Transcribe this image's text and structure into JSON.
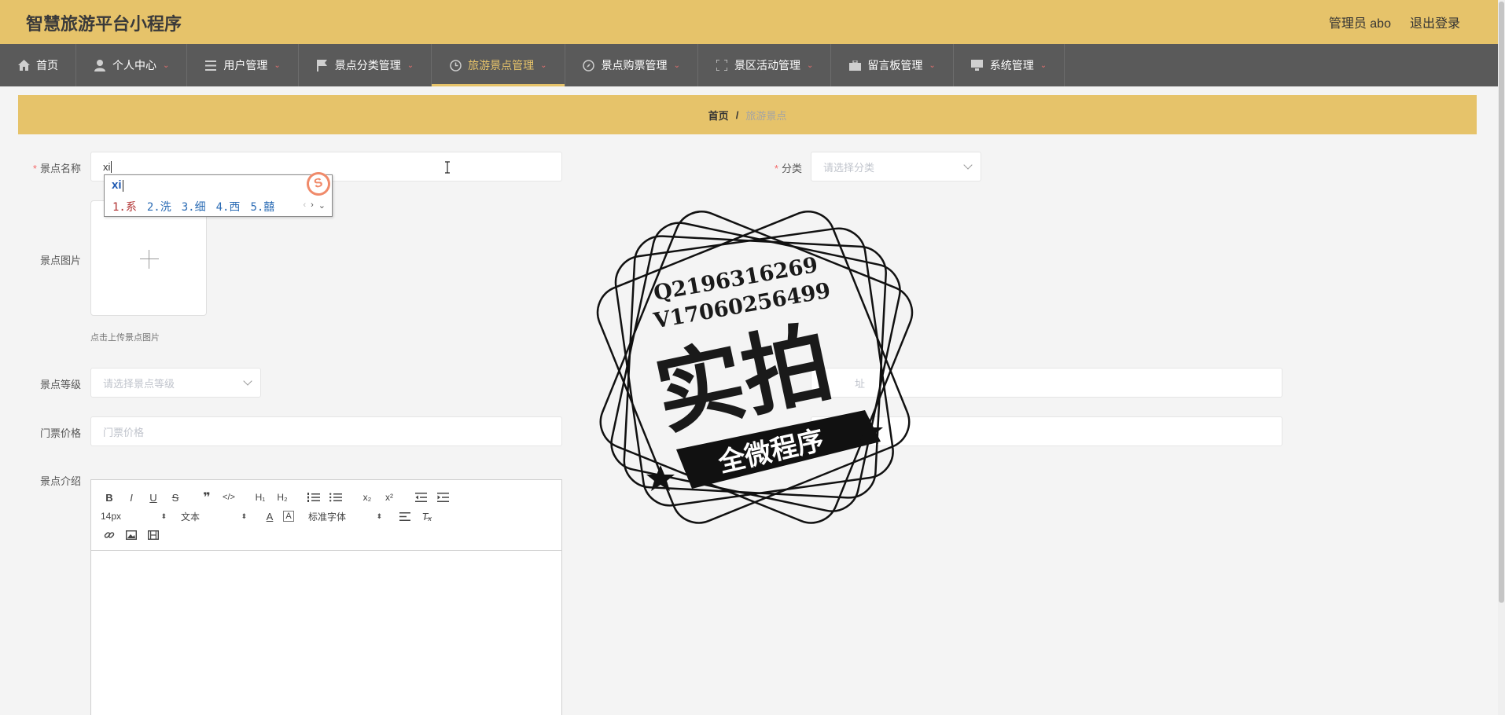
{
  "header": {
    "title": "智慧旅游平台小程序",
    "user_label": "管理员 abo",
    "logout_label": "退出登录"
  },
  "nav": {
    "items": [
      {
        "label": "首页",
        "icon": "home-icon"
      },
      {
        "label": "个人中心",
        "icon": "user-icon"
      },
      {
        "label": "用户管理",
        "icon": "list-icon"
      },
      {
        "label": "景点分类管理",
        "icon": "flag-icon"
      },
      {
        "label": "旅游景点管理",
        "icon": "clock-icon"
      },
      {
        "label": "景点购票管理",
        "icon": "compass-icon"
      },
      {
        "label": "景区活动管理",
        "icon": "fullscreen-icon"
      },
      {
        "label": "留言板管理",
        "icon": "briefcase-icon"
      },
      {
        "label": "系统管理",
        "icon": "monitor-icon"
      }
    ],
    "active": "旅游景点管理"
  },
  "breadcrumb": {
    "home": "首页",
    "separator": "/",
    "current": "旅游景点"
  },
  "form": {
    "name_label": "景点名称",
    "name_value": "xi",
    "category_label": "分类",
    "category_placeholder": "请选择分类",
    "image_label": "景点图片",
    "image_hint": "点击上传景点图片",
    "level_label": "景点等级",
    "level_placeholder": "请选择景点等级",
    "address_placeholder": "址",
    "price_label": "门票价格",
    "price_placeholder": "门票价格",
    "intro_label": "景点介绍"
  },
  "ime": {
    "composition": "xi",
    "candidates": [
      "1.系",
      "2.洗",
      "3.细",
      "4.西",
      "5.囍"
    ],
    "logo": "S"
  },
  "editor": {
    "font_size": "14px",
    "header_select": "文本",
    "font_family": "标准字体"
  },
  "stamp": {
    "line1": "Q2196316269",
    "line2": "V17060256499",
    "big": "实拍",
    "banner": "全微程序"
  }
}
